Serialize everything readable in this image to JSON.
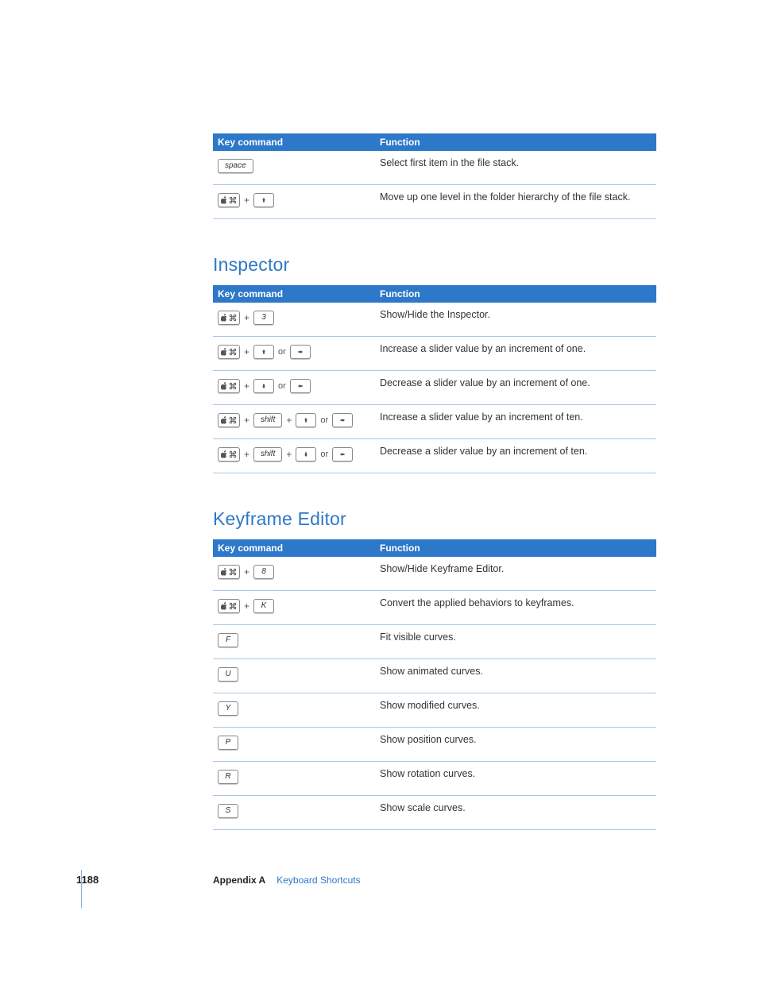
{
  "headers": {
    "key_command": "Key command",
    "function": "Function"
  },
  "tables": [
    {
      "heading": null,
      "rows": [
        {
          "keys": [
            {
              "type": "key",
              "label": "space",
              "wide": true
            }
          ],
          "function": "Select first item in the file stack."
        },
        {
          "keys": [
            {
              "type": "cmd"
            },
            {
              "type": "plus"
            },
            {
              "type": "arrow",
              "dir": "up"
            }
          ],
          "function": "Move up one level in the folder hierarchy of the file stack."
        }
      ]
    },
    {
      "heading": "Inspector",
      "rows": [
        {
          "keys": [
            {
              "type": "cmd"
            },
            {
              "type": "plus"
            },
            {
              "type": "key",
              "label": "3"
            }
          ],
          "function": "Show/Hide the Inspector."
        },
        {
          "keys": [
            {
              "type": "cmd"
            },
            {
              "type": "plus"
            },
            {
              "type": "arrow",
              "dir": "up"
            },
            {
              "type": "or"
            },
            {
              "type": "arrow",
              "dir": "right"
            }
          ],
          "function": "Increase a slider value by an increment of one."
        },
        {
          "keys": [
            {
              "type": "cmd"
            },
            {
              "type": "plus"
            },
            {
              "type": "arrow",
              "dir": "down"
            },
            {
              "type": "or"
            },
            {
              "type": "arrow",
              "dir": "left"
            }
          ],
          "function": "Decrease a slider value by an increment of one."
        },
        {
          "keys": [
            {
              "type": "cmd"
            },
            {
              "type": "plus"
            },
            {
              "type": "key",
              "label": "shift",
              "wide": true
            },
            {
              "type": "plus"
            },
            {
              "type": "arrow",
              "dir": "up"
            },
            {
              "type": "or"
            },
            {
              "type": "arrow",
              "dir": "right"
            }
          ],
          "function": "Increase a slider value by an increment of ten."
        },
        {
          "keys": [
            {
              "type": "cmd"
            },
            {
              "type": "plus"
            },
            {
              "type": "key",
              "label": "shift",
              "wide": true
            },
            {
              "type": "plus"
            },
            {
              "type": "arrow",
              "dir": "down"
            },
            {
              "type": "or"
            },
            {
              "type": "arrow",
              "dir": "left"
            }
          ],
          "function": "Decrease a slider value by an increment of ten."
        }
      ]
    },
    {
      "heading": "Keyframe Editor",
      "rows": [
        {
          "keys": [
            {
              "type": "cmd"
            },
            {
              "type": "plus"
            },
            {
              "type": "key",
              "label": "8"
            }
          ],
          "function": "Show/Hide Keyframe Editor."
        },
        {
          "keys": [
            {
              "type": "cmd"
            },
            {
              "type": "plus"
            },
            {
              "type": "key",
              "label": "K"
            }
          ],
          "function": "Convert the applied behaviors to keyframes."
        },
        {
          "keys": [
            {
              "type": "key",
              "label": "F"
            }
          ],
          "function": "Fit visible curves."
        },
        {
          "keys": [
            {
              "type": "key",
              "label": "U"
            }
          ],
          "function": "Show animated curves."
        },
        {
          "keys": [
            {
              "type": "key",
              "label": "Y"
            }
          ],
          "function": "Show modified curves."
        },
        {
          "keys": [
            {
              "type": "key",
              "label": "P"
            }
          ],
          "function": "Show position curves."
        },
        {
          "keys": [
            {
              "type": "key",
              "label": "R"
            }
          ],
          "function": "Show rotation curves."
        },
        {
          "keys": [
            {
              "type": "key",
              "label": "S"
            }
          ],
          "function": "Show scale curves."
        }
      ]
    }
  ],
  "footer": {
    "page_number": "1188",
    "appendix": "Appendix A",
    "chapter": "Keyboard Shortcuts"
  },
  "labels": {
    "plus": "+",
    "or": "or"
  }
}
